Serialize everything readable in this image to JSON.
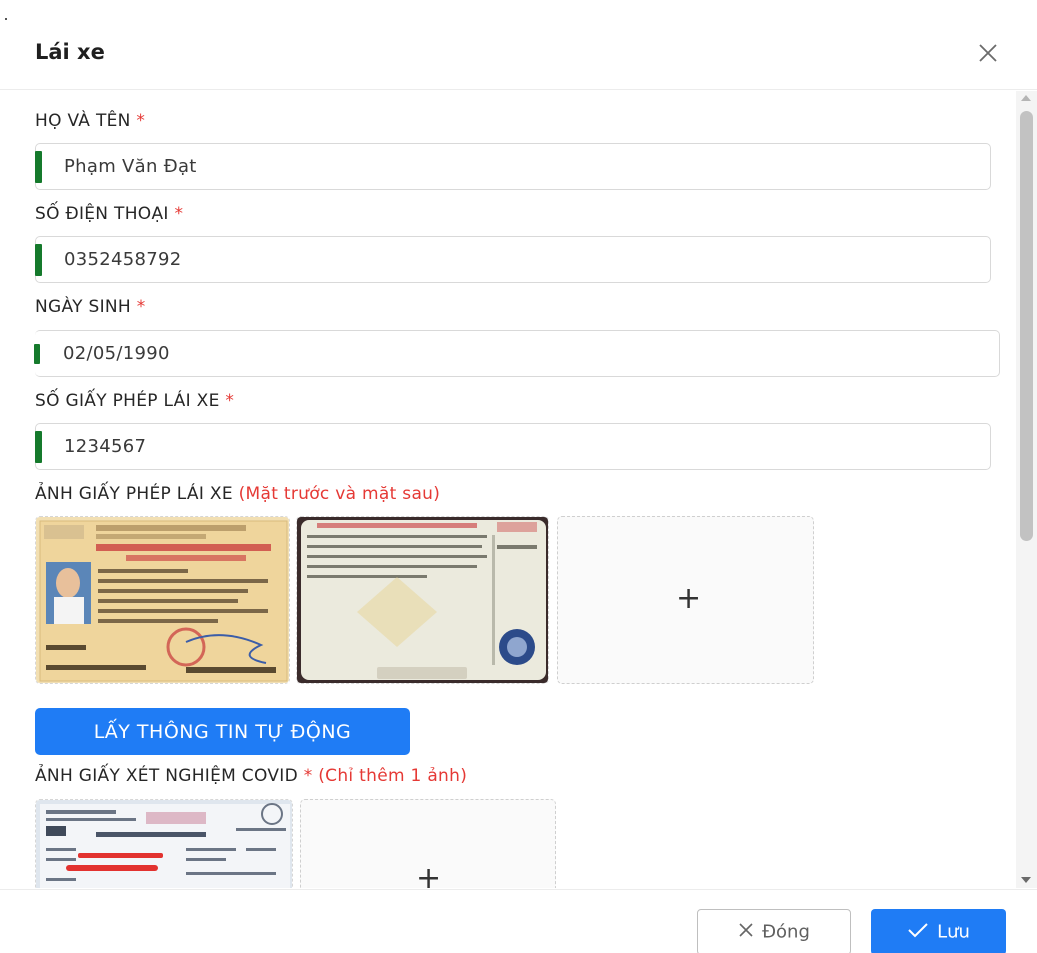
{
  "modal": {
    "title": "Lái xe",
    "close_icon": "close-icon"
  },
  "form": {
    "full_name": {
      "label": "HỌ VÀ TÊN",
      "required_mark": "*",
      "value": "Phạm Văn Đạt"
    },
    "phone": {
      "label": "SỐ ĐIỆN THOẠI",
      "required_mark": "*",
      "value": "0352458792"
    },
    "birth_date": {
      "label": "NGÀY SINH",
      "required_mark": "*",
      "value": "02/05/1990"
    },
    "license_number": {
      "label": "SỐ GIẤY PHÉP LÁI XE",
      "required_mark": "*",
      "value": "1234567"
    },
    "license_photos": {
      "label": "ẢNH GIẤY PHÉP LÁI XE",
      "note": "(Mặt trước và mặt sau)",
      "add_symbol": "+"
    },
    "auto_fill_button": "LẤY THÔNG TIN TỰ ĐỘNG",
    "covid_photo": {
      "label": "ẢNH GIẤY XÉT NGHIỆM COVID",
      "required_mark": "*",
      "note": "(Chỉ thêm 1 ảnh)",
      "add_symbol": "+"
    }
  },
  "footer": {
    "close_label": "Đóng",
    "save_label": "Lưu"
  },
  "colors": {
    "primary": "#1f7cf5",
    "required": "#e53935",
    "field_indicator": "#157a2c"
  }
}
